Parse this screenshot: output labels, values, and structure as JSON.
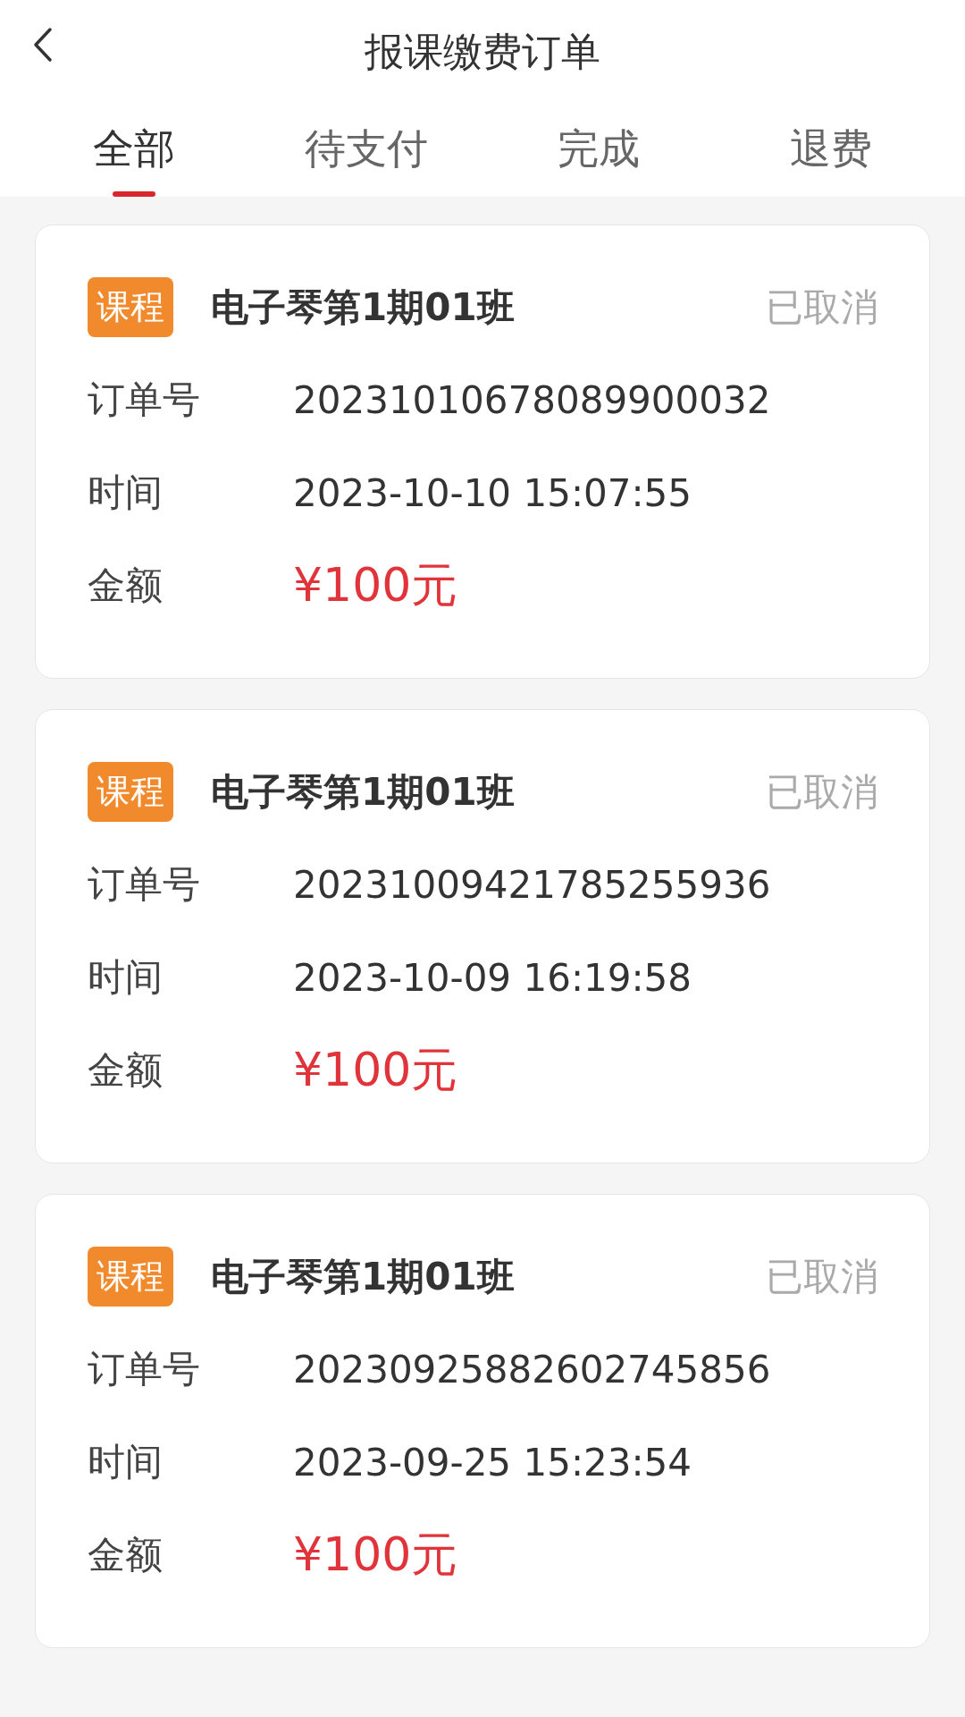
{
  "header": {
    "title": "报课缴费订单"
  },
  "tabs": [
    {
      "label": "全部",
      "selected": true
    },
    {
      "label": "待支付",
      "selected": false
    },
    {
      "label": "完成",
      "selected": false
    },
    {
      "label": "退费",
      "selected": false
    }
  ],
  "orders": [
    {
      "tag": "课程",
      "title": "电子琴第1期01班",
      "status": "已取消",
      "fields": [
        {
          "label": "订单号",
          "value": "20231010678089900032"
        },
        {
          "label": "时间",
          "value": "2023-10-10 15:07:55"
        }
      ],
      "amount": {
        "label": "金额",
        "value": "¥100元"
      }
    },
    {
      "tag": "课程",
      "title": "电子琴第1期01班",
      "status": "已取消",
      "fields": [
        {
          "label": "订单号",
          "value": "20231009421785255936"
        },
        {
          "label": "时间",
          "value": "2023-10-09 16:19:58"
        }
      ],
      "amount": {
        "label": "金额",
        "value": "¥100元"
      }
    },
    {
      "tag": "课程",
      "title": "电子琴第1期01班",
      "status": "已取消",
      "fields": [
        {
          "label": "订单号",
          "value": "20230925882602745856"
        },
        {
          "label": "时间",
          "value": "2023-09-25 15:23:54"
        }
      ],
      "amount": {
        "label": "金额",
        "value": "¥100元"
      }
    }
  ]
}
